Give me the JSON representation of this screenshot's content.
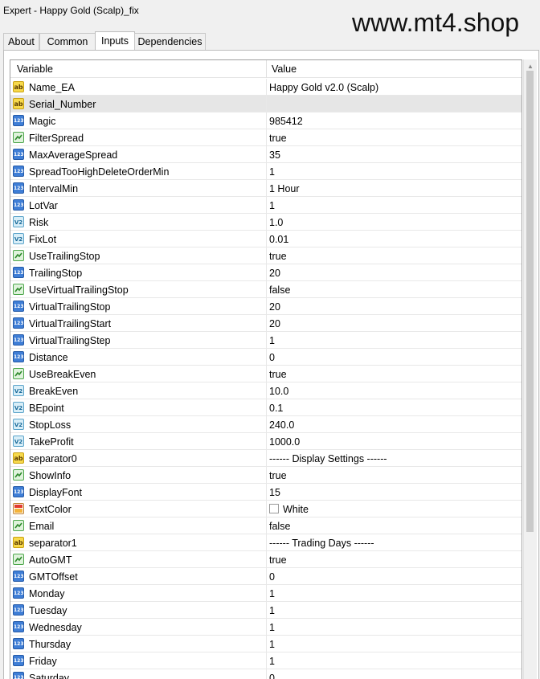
{
  "window": {
    "title": "Expert - Happy Gold (Scalp)_fix",
    "watermark": "www.mt4.shop"
  },
  "tabs": [
    {
      "label": "About"
    },
    {
      "label": "Common"
    },
    {
      "label": "Inputs",
      "active": true
    },
    {
      "label": "Dependencies"
    }
  ],
  "table": {
    "headers": {
      "variable": "Variable",
      "value": "Value"
    },
    "rows": [
      {
        "name": "Name_EA",
        "value": "Happy Gold v2.0 (Scalp)",
        "icon": "string-icon"
      },
      {
        "name": "Serial_Number",
        "value": "",
        "icon": "string-icon",
        "highlight": true
      },
      {
        "name": "Magic",
        "value": "985412",
        "icon": "integer-icon"
      },
      {
        "name": "FilterSpread",
        "value": "true",
        "icon": "boolean-icon"
      },
      {
        "name": "MaxAverageSpread",
        "value": "35",
        "icon": "integer-icon"
      },
      {
        "name": "SpreadTooHighDeleteOrderMin",
        "value": "1",
        "icon": "integer-icon"
      },
      {
        "name": "IntervalMin",
        "value": "1 Hour",
        "icon": "integer-icon"
      },
      {
        "name": "LotVar",
        "value": "1",
        "icon": "integer-icon"
      },
      {
        "name": "Risk",
        "value": "1.0",
        "icon": "double-icon"
      },
      {
        "name": "FixLot",
        "value": "0.01",
        "icon": "double-icon"
      },
      {
        "name": "UseTrailingStop",
        "value": "true",
        "icon": "boolean-icon"
      },
      {
        "name": "TrailingStop",
        "value": "20",
        "icon": "integer-icon"
      },
      {
        "name": "UseVirtualTrailingStop",
        "value": "false",
        "icon": "boolean-icon"
      },
      {
        "name": "VirtualTrailingStop",
        "value": "20",
        "icon": "integer-icon"
      },
      {
        "name": "VirtualTrailingStart",
        "value": "20",
        "icon": "integer-icon"
      },
      {
        "name": "VirtualTrailingStep",
        "value": "1",
        "icon": "integer-icon"
      },
      {
        "name": "Distance",
        "value": "0",
        "icon": "integer-icon"
      },
      {
        "name": "UseBreakEven",
        "value": "true",
        "icon": "boolean-icon"
      },
      {
        "name": "BreakEven",
        "value": "10.0",
        "icon": "double-icon"
      },
      {
        "name": "BEpoint",
        "value": "0.1",
        "icon": "double-icon"
      },
      {
        "name": "StopLoss",
        "value": "240.0",
        "icon": "double-icon"
      },
      {
        "name": "TakeProfit",
        "value": "1000.0",
        "icon": "double-icon"
      },
      {
        "name": "separator0",
        "value": "------ Display Settings ------",
        "icon": "string-icon"
      },
      {
        "name": "ShowInfo",
        "value": "true",
        "icon": "boolean-icon"
      },
      {
        "name": "DisplayFont",
        "value": "15",
        "icon": "integer-icon"
      },
      {
        "name": "TextColor",
        "value": "White",
        "icon": "color-icon",
        "swatch": "#ffffff"
      },
      {
        "name": "Email",
        "value": "false",
        "icon": "boolean-icon"
      },
      {
        "name": "separator1",
        "value": "------ Trading Days ------",
        "icon": "string-icon"
      },
      {
        "name": "AutoGMT",
        "value": "true",
        "icon": "boolean-icon"
      },
      {
        "name": "GMTOffset",
        "value": "0",
        "icon": "integer-icon"
      },
      {
        "name": "Monday",
        "value": "1",
        "icon": "integer-icon"
      },
      {
        "name": "Tuesday",
        "value": "1",
        "icon": "integer-icon"
      },
      {
        "name": "Wednesday",
        "value": "1",
        "icon": "integer-icon"
      },
      {
        "name": "Thursday",
        "value": "1",
        "icon": "integer-icon"
      },
      {
        "name": "Friday",
        "value": "1",
        "icon": "integer-icon"
      },
      {
        "name": "Saturday",
        "value": "0",
        "icon": "integer-icon"
      }
    ]
  },
  "colors": {
    "string_icon": "#f7d94c",
    "integer_icon": "#3f7ed6",
    "boolean_icon": "#4ca64a",
    "double_icon": "#5aa3c9",
    "highlight_row": "#e6e6e6"
  }
}
